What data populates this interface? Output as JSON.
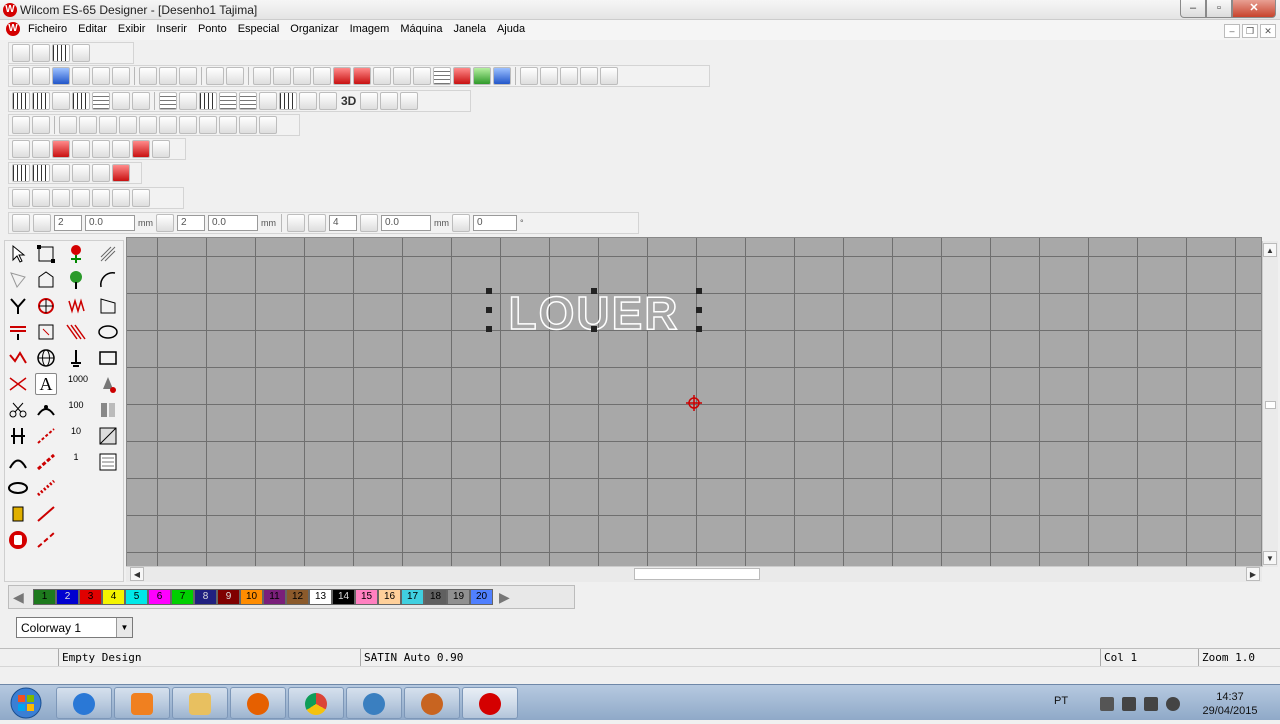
{
  "window": {
    "title": "Wilcom ES-65 Designer - [Desenho1      Tajima]",
    "app_badge": "W",
    "min": "‒",
    "max": "▫",
    "close": "✕"
  },
  "menu": {
    "items": [
      "Ficheiro",
      "Editar",
      "Exibir",
      "Inserir",
      "Ponto",
      "Especial",
      "Organizar",
      "Imagem",
      "Máquina",
      "Janela",
      "Ajuda"
    ],
    "mdi_min": "‒",
    "mdi_restore": "❐",
    "mdi_close": "✕"
  },
  "toolbar": {
    "label_3d": "3D"
  },
  "params_bar": {
    "field1": "2",
    "field2": "0.0",
    "unit1": "mm",
    "field3": "2",
    "field4": "0.0",
    "unit2": "mm",
    "field5": "4",
    "field6": "0.0",
    "unit3": "mm",
    "field7": "0",
    "unit4": "°"
  },
  "toolbox": {
    "text_tool_label": "A",
    "label_1000": "1000",
    "label_100": "100",
    "label_10": "10",
    "label_1": "1"
  },
  "design": {
    "text": "LOUER"
  },
  "palette": {
    "left_arrow": "◀",
    "right_arrow": "▶",
    "swatches": [
      {
        "n": "1",
        "c": "#1d7a1d"
      },
      {
        "n": "2",
        "c": "#0000d0"
      },
      {
        "n": "3",
        "c": "#e00000"
      },
      {
        "n": "4",
        "c": "#f4f400"
      },
      {
        "n": "5",
        "c": "#00e8e8"
      },
      {
        "n": "6",
        "c": "#ff00ff"
      },
      {
        "n": "7",
        "c": "#00d000"
      },
      {
        "n": "8",
        "c": "#202080"
      },
      {
        "n": "9",
        "c": "#800000"
      },
      {
        "n": "10",
        "c": "#ff8c00"
      },
      {
        "n": "11",
        "c": "#7a1f7a"
      },
      {
        "n": "12",
        "c": "#8b5a2b"
      },
      {
        "n": "13",
        "c": "#ffffff"
      },
      {
        "n": "14",
        "c": "#000000"
      },
      {
        "n": "15",
        "c": "#ff80c0"
      },
      {
        "n": "16",
        "c": "#ffd09a"
      },
      {
        "n": "17",
        "c": "#40d0e0"
      },
      {
        "n": "18",
        "c": "#606060"
      },
      {
        "n": "19",
        "c": "#909090"
      },
      {
        "n": "20",
        "c": "#5080ff"
      }
    ]
  },
  "colorway": {
    "value": "Colorway 1",
    "arrow": "▼"
  },
  "status": {
    "message": "Empty Design",
    "stitch": "SATIN Auto  0.90",
    "col": "Col 1",
    "zoom": "Zoom 1.0"
  },
  "taskbar": {
    "lang": "PT",
    "time": "14:37",
    "date": "29/04/2015"
  },
  "colors": {
    "accent": "#d40000",
    "canvas": "#a8a8a8",
    "grid": "#6f6f6f"
  }
}
